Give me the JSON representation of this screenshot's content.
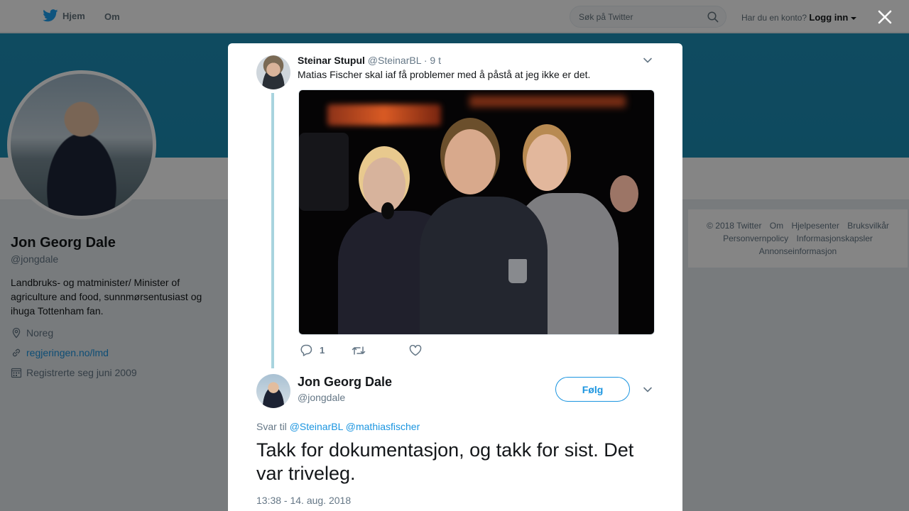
{
  "nav": {
    "home_label": "Hjem",
    "about_label": "Om",
    "search_placeholder": "Søk på Twitter",
    "account_prompt": "Har du en konto?",
    "login_label": "Logg inn"
  },
  "profile": {
    "name": "Jon Georg Dale",
    "handle": "@jongdale",
    "bio": "Landbruks- og matminister/ Minister of agriculture and food, sunnmørsentusiast og ihuga Tottenham fan.",
    "location": "Noreg",
    "website": "regjeringen.no/lmd",
    "joined": "Registrerte seg juni 2009"
  },
  "footer": {
    "links": [
      "© 2018 Twitter",
      "Om",
      "Hjelpesenter",
      "Bruksvilkår",
      "Personvernpolicy",
      "Informasjonskapsler",
      "Annonseinformasjon"
    ]
  },
  "modal": {
    "parent_tweet": {
      "name": "Steinar Stupul",
      "handle": "@SteinarBL",
      "time": "· 9 t",
      "text": "Matias Fischer skal iaf få problemer med å påstå at jeg ikke er det.",
      "reply_count": "1"
    },
    "main_tweet": {
      "name": "Jon Georg Dale",
      "handle": "@jongdale",
      "follow_label": "Følg",
      "reply_prefix": "Svar til",
      "mention_1": "@SteinarBL",
      "mention_2": "@mathiasfischer",
      "text": "Takk for dokumentasjon, og takk for sist. Det var triveleg.",
      "timestamp": "13:38 - 14. aug. 2018"
    }
  },
  "colors": {
    "brand": "#1da1f2",
    "link": "#1b95e0",
    "banner": "#1e90b9"
  }
}
